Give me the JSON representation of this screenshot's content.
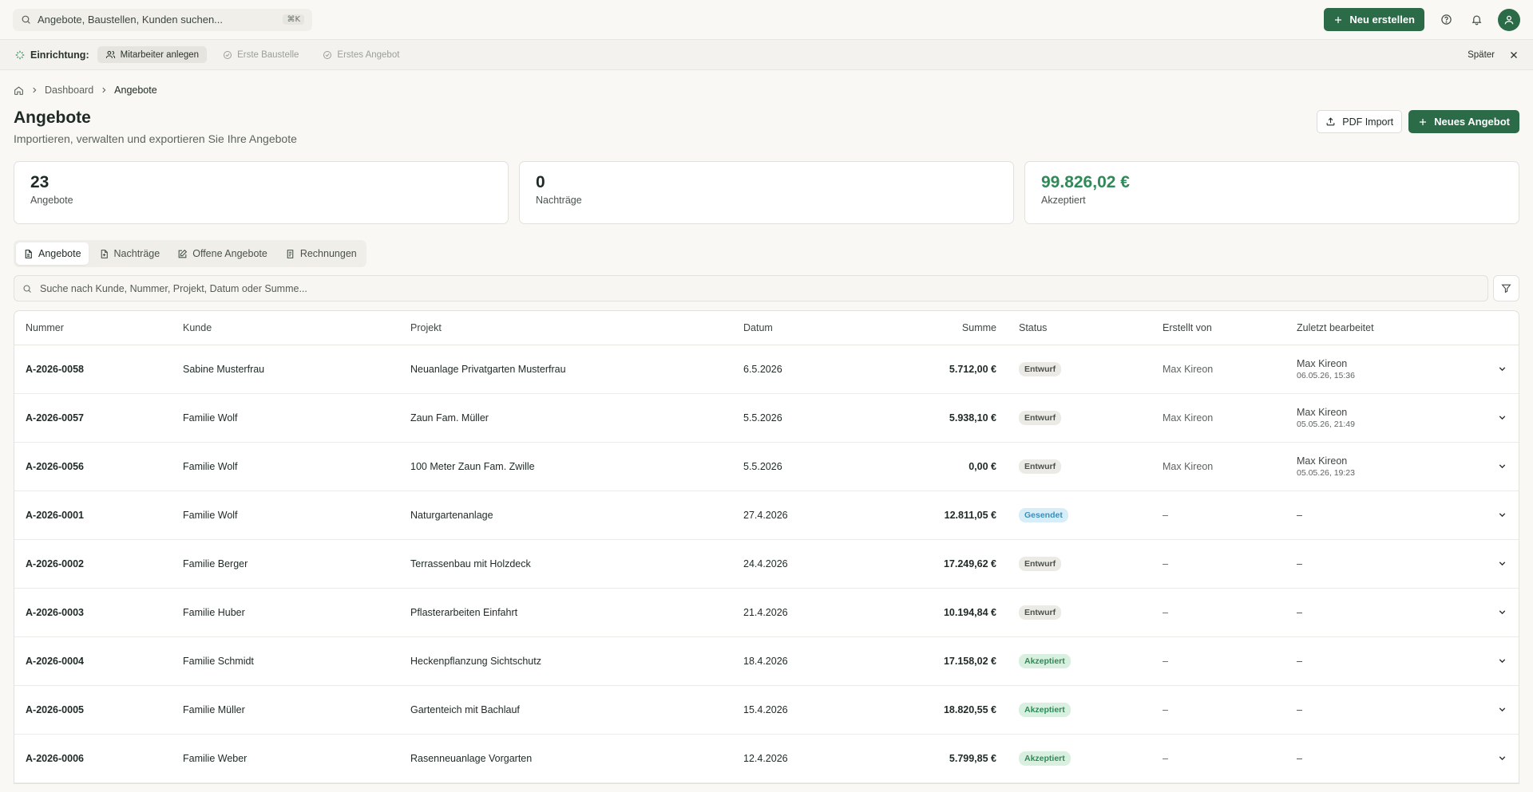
{
  "topbar": {
    "search_placeholder": "Angebote, Baustellen, Kunden suchen...",
    "search_shortcut": "⌘K",
    "new_button": "Neu erstellen"
  },
  "setup": {
    "label": "Einrichtung:",
    "steps": [
      {
        "label": "Mitarbeiter anlegen"
      },
      {
        "label": "Erste Baustelle"
      },
      {
        "label": "Erstes Angebot"
      }
    ],
    "later": "Später"
  },
  "breadcrumb": {
    "home_item": "Dashboard",
    "current": "Angebote"
  },
  "page": {
    "title": "Angebote",
    "subtitle": "Importieren, verwalten und exportieren Sie Ihre Angebote",
    "pdf_import": "PDF Import",
    "new_offer": "Neues Angebot"
  },
  "stats": [
    {
      "value": "23",
      "label": "Angebote"
    },
    {
      "value": "0",
      "label": "Nachträge"
    },
    {
      "value": "99.826,02 €",
      "label": "Akzeptiert"
    }
  ],
  "tabs": [
    {
      "label": "Angebote"
    },
    {
      "label": "Nachträge"
    },
    {
      "label": "Offene Angebote"
    },
    {
      "label": "Rechnungen"
    }
  ],
  "table_search_placeholder": "Suche nach Kunde, Nummer, Projekt, Datum oder Summe...",
  "columns": {
    "nummer": "Nummer",
    "kunde": "Kunde",
    "projekt": "Projekt",
    "datum": "Datum",
    "summe": "Summe",
    "status": "Status",
    "erstellt": "Erstellt von",
    "bearbeitet": "Zuletzt bearbeitet"
  },
  "rows": [
    {
      "nummer": "A-2026-0058",
      "kunde": "Sabine Musterfrau",
      "projekt": "Neuanlage Privatgarten Musterfrau",
      "datum": "6.5.2026",
      "summe": "5.712,00 €",
      "status": "Entwurf",
      "erstellt": "Max Kireon",
      "bearbeitet_name": "Max Kireon",
      "bearbeitet_zeit": "06.05.26, 15:36"
    },
    {
      "nummer": "A-2026-0057",
      "kunde": "Familie Wolf",
      "projekt": "Zaun Fam. Müller",
      "datum": "5.5.2026",
      "summe": "5.938,10 €",
      "status": "Entwurf",
      "erstellt": "Max Kireon",
      "bearbeitet_name": "Max Kireon",
      "bearbeitet_zeit": "05.05.26, 21:49"
    },
    {
      "nummer": "A-2026-0056",
      "kunde": "Familie Wolf",
      "projekt": "100 Meter Zaun Fam. Zwille",
      "datum": "5.5.2026",
      "summe": "0,00 €",
      "status": "Entwurf",
      "erstellt": "Max Kireon",
      "bearbeitet_name": "Max Kireon",
      "bearbeitet_zeit": "05.05.26, 19:23"
    },
    {
      "nummer": "A-2026-0001",
      "kunde": "Familie Wolf",
      "projekt": "Naturgartenanlage",
      "datum": "27.4.2026",
      "summe": "12.811,05 €",
      "status": "Gesendet",
      "erstellt": "–",
      "bearbeitet_name": "–",
      "bearbeitet_zeit": ""
    },
    {
      "nummer": "A-2026-0002",
      "kunde": "Familie Berger",
      "projekt": "Terrassenbau mit Holzdeck",
      "datum": "24.4.2026",
      "summe": "17.249,62 €",
      "status": "Entwurf",
      "erstellt": "–",
      "bearbeitet_name": "–",
      "bearbeitet_zeit": ""
    },
    {
      "nummer": "A-2026-0003",
      "kunde": "Familie Huber",
      "projekt": "Pflasterarbeiten Einfahrt",
      "datum": "21.4.2026",
      "summe": "10.194,84 €",
      "status": "Entwurf",
      "erstellt": "–",
      "bearbeitet_name": "–",
      "bearbeitet_zeit": ""
    },
    {
      "nummer": "A-2026-0004",
      "kunde": "Familie Schmidt",
      "projekt": "Heckenpflanzung Sichtschutz",
      "datum": "18.4.2026",
      "summe": "17.158,02 €",
      "status": "Akzeptiert",
      "erstellt": "–",
      "bearbeitet_name": "–",
      "bearbeitet_zeit": ""
    },
    {
      "nummer": "A-2026-0005",
      "kunde": "Familie Müller",
      "projekt": "Gartenteich mit Bachlauf",
      "datum": "15.4.2026",
      "summe": "18.820,55 €",
      "status": "Akzeptiert",
      "erstellt": "–",
      "bearbeitet_name": "–",
      "bearbeitet_zeit": ""
    },
    {
      "nummer": "A-2026-0006",
      "kunde": "Familie Weber",
      "projekt": "Rasenneuanlage Vorgarten",
      "datum": "12.4.2026",
      "summe": "5.799,85 €",
      "status": "Akzeptiert",
      "erstellt": "–",
      "bearbeitet_name": "–",
      "bearbeitet_zeit": ""
    }
  ]
}
